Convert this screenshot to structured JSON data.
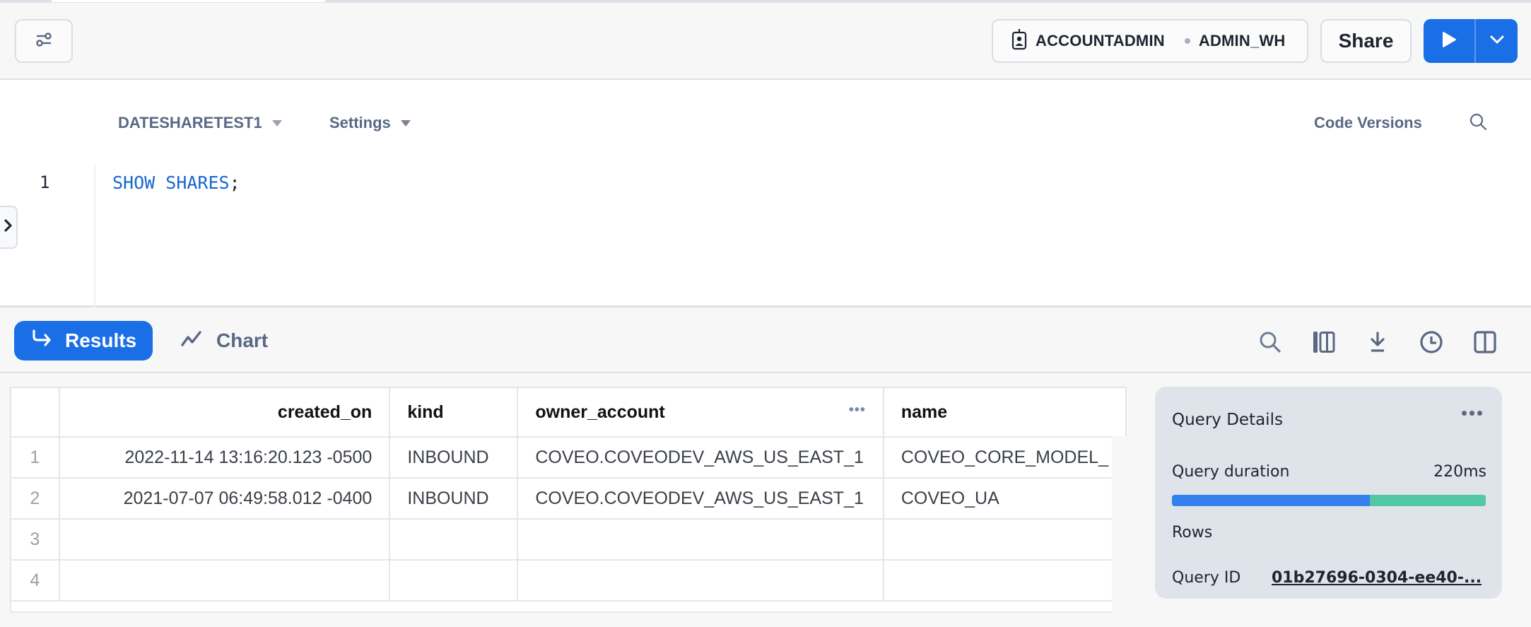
{
  "header": {
    "filter_icon": "sliders-icon",
    "role": "ACCOUNTADMIN",
    "warehouse": "ADMIN_WH",
    "share_label": "Share",
    "run_icon": "play-icon",
    "run_more_icon": "chevron-down-icon"
  },
  "editor": {
    "database_selector": "DATESHARETEST1",
    "settings_label": "Settings",
    "code_versions_label": "Code Versions",
    "lines": [
      {
        "number": "1",
        "keyword_1": "SHOW",
        "keyword_2": "SHARES",
        "tail": ";"
      }
    ]
  },
  "results_toolbar": {
    "results_label": "Results",
    "chart_label": "Chart",
    "icons": [
      "search-icon",
      "columns-icon",
      "download-icon",
      "history-icon",
      "split-panel-icon"
    ]
  },
  "results_table": {
    "columns": [
      "created_on",
      "kind",
      "owner_account",
      "name"
    ],
    "rows": [
      {
        "num": "1",
        "created_on": "2022-11-14 13:16:20.123 -0500",
        "kind": "INBOUND",
        "owner_account": "COVEO.COVEODEV_AWS_US_EAST_1",
        "name": "COVEO_CORE_MODEL_"
      },
      {
        "num": "2",
        "created_on": "2021-07-07 06:49:58.012 -0400",
        "kind": "INBOUND",
        "owner_account": "COVEO.COVEODEV_AWS_US_EAST_1",
        "name": "COVEO_UA"
      },
      {
        "num": "3",
        "created_on": "",
        "kind": "",
        "owner_account": "",
        "name": ""
      },
      {
        "num": "4",
        "created_on": "",
        "kind": "",
        "owner_account": "",
        "name": ""
      }
    ]
  },
  "query_details": {
    "title": "Query Details",
    "duration_label": "Query duration",
    "duration_value": "220ms",
    "duration_breakdown_fraction": [
      0.63,
      0.37
    ],
    "duration_colors": [
      "#3380ee",
      "#52c9a4"
    ],
    "rows_label": "Rows",
    "query_id_label": "Query ID",
    "query_id_value": "01b27696-0304-ee40-..."
  },
  "colors": {
    "accent": "#1a6ee6",
    "text_muted": "#5a6883"
  }
}
